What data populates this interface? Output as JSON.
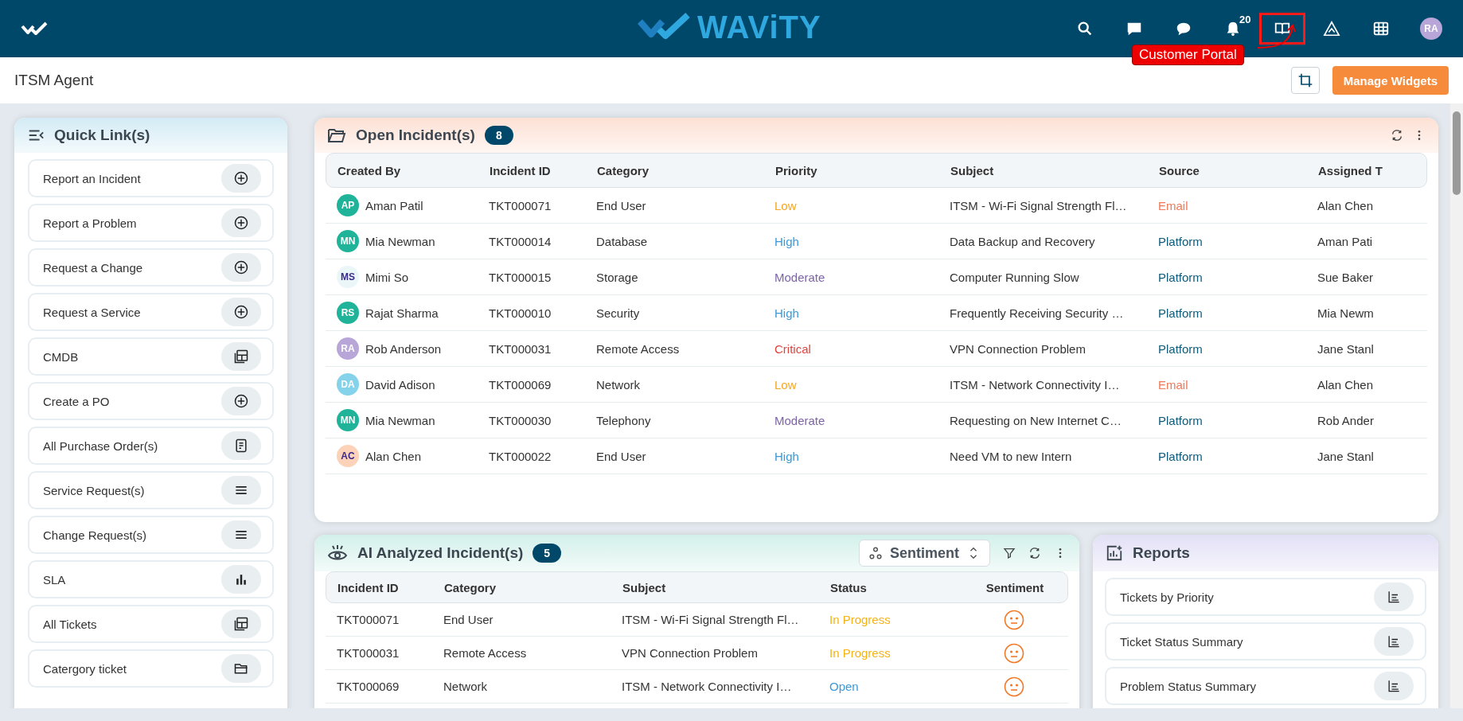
{
  "header": {
    "logo_text": "WAViTY",
    "nav": [
      {
        "highlighted": false
      },
      {
        "highlighted": false
      },
      {
        "highlighted": false
      },
      {
        "badge": "20",
        "highlighted": false
      },
      {
        "highlighted": true
      },
      {
        "highlighted": false
      },
      {
        "highlighted": false
      }
    ],
    "avatar": {
      "initials": "RA",
      "color": "#b9a6d9"
    },
    "callout": {
      "label": "Customer Portal"
    }
  },
  "subheader": {
    "title": "ITSM Agent",
    "button": "Manage Widgets"
  },
  "quick_links": {
    "title": "Quick Link(s)",
    "items": [
      {
        "label": "Report an Incident",
        "kind": "plus"
      },
      {
        "label": "Report a Problem",
        "kind": "plus"
      },
      {
        "label": "Request a Change",
        "kind": "plus"
      },
      {
        "label": "Request a Service",
        "kind": "plus"
      },
      {
        "label": "CMDB",
        "kind": "layout"
      },
      {
        "label": "Create a PO",
        "kind": "plus"
      },
      {
        "label": "All Purchase Order(s)",
        "kind": "doc"
      },
      {
        "label": "Service Request(s)",
        "kind": "lines"
      },
      {
        "label": "Change Request(s)",
        "kind": "lines"
      },
      {
        "label": "SLA",
        "kind": "bars"
      },
      {
        "label": "All Tickets",
        "kind": "layout"
      },
      {
        "label": "Catergory ticket",
        "kind": "folder"
      }
    ]
  },
  "open_incidents": {
    "title": "Open Incident(s)",
    "count": "8",
    "columns": [
      "Created By",
      "Incident ID",
      "Category",
      "Priority",
      "Subject",
      "Source",
      "Assigned T"
    ],
    "rows": [
      {
        "initials": "AP",
        "color": "#1fb39a",
        "created_by": "Aman Patil",
        "id": "TKT000071",
        "category": "End User",
        "priority": {
          "text": "Low",
          "color": "#f5a623"
        },
        "subject": "ITSM - Wi-Fi Signal Strength Fl…",
        "source": {
          "text": "Email",
          "color": "#f07857"
        },
        "assigned": "Alan Chen"
      },
      {
        "initials": "MN",
        "color": "#1fb39a",
        "created_by": "Mia Newman",
        "id": "TKT000014",
        "category": "Database",
        "priority": {
          "text": "High",
          "color": "#3a9ad9"
        },
        "subject": "Data Backup and Recovery",
        "source": {
          "text": "Platform",
          "color": "#0d5a7a"
        },
        "assigned": "Aman Pati"
      },
      {
        "initials": "MS",
        "color": "#eaf6f8",
        "created_by": "Mimi So",
        "id": "TKT000015",
        "category": "Storage",
        "priority": {
          "text": "Moderate",
          "color": "#7d64a8"
        },
        "subject": "Computer Running Slow",
        "source": {
          "text": "Platform",
          "color": "#0d5a7a"
        },
        "assigned": "Sue Baker"
      },
      {
        "initials": "RS",
        "color": "#1fb39a",
        "created_by": "Rajat Sharma",
        "id": "TKT000010",
        "category": "Security",
        "priority": {
          "text": "High",
          "color": "#3a9ad9"
        },
        "subject": "Frequently Receiving Security …",
        "source": {
          "text": "Platform",
          "color": "#0d5a7a"
        },
        "assigned": "Mia Newm"
      },
      {
        "initials": "RA",
        "color": "#b9a6d9",
        "created_by": "Rob Anderson",
        "id": "TKT000031",
        "category": "Remote Access",
        "priority": {
          "text": "Critical",
          "color": "#e0443c"
        },
        "subject": "VPN Connection Problem",
        "source": {
          "text": "Platform",
          "color": "#0d5a7a"
        },
        "assigned": "Jane Stanl"
      },
      {
        "initials": "DA",
        "color": "#84d3ea",
        "created_by": "David Adison",
        "id": "TKT000069",
        "category": "Network",
        "priority": {
          "text": "Low",
          "color": "#f5a623"
        },
        "subject": "ITSM - Network Connectivity I…",
        "source": {
          "text": "Email",
          "color": "#f07857"
        },
        "assigned": "Alan Chen"
      },
      {
        "initials": "MN",
        "color": "#1fb39a",
        "created_by": "Mia Newman",
        "id": "TKT000030",
        "category": "Telephony",
        "priority": {
          "text": "Moderate",
          "color": "#7d64a8"
        },
        "subject": "Requesting on New Internet C…",
        "source": {
          "text": "Platform",
          "color": "#0d5a7a"
        },
        "assigned": "Rob Ander"
      },
      {
        "initials": "AC",
        "color": "#fcd2b8",
        "created_by": "Alan Chen",
        "id": "TKT000022",
        "category": "End User",
        "priority": {
          "text": "High",
          "color": "#3a9ad9"
        },
        "subject": "Need VM to new Intern",
        "source": {
          "text": "Platform",
          "color": "#0d5a7a"
        },
        "assigned": "Jane Stanl"
      }
    ]
  },
  "ai_incidents": {
    "title": "AI Analyzed Incident(s)",
    "count": "5",
    "selector": "Sentiment",
    "columns": [
      "Incident ID",
      "Category",
      "Subject",
      "Status",
      "Sentiment"
    ],
    "rows": [
      {
        "id": "TKT000071",
        "category": "End User",
        "subject": "ITSM - Wi-Fi Signal Strength Fl…",
        "status": {
          "text": "In Progress",
          "color": "#f5b316"
        }
      },
      {
        "id": "TKT000031",
        "category": "Remote Access",
        "subject": "VPN Connection Problem",
        "status": {
          "text": "In Progress",
          "color": "#f5b316"
        }
      },
      {
        "id": "TKT000069",
        "category": "Network",
        "subject": "ITSM - Network Connectivity I…",
        "status": {
          "text": "Open",
          "color": "#3a9ad9"
        }
      }
    ]
  },
  "reports": {
    "title": "Reports",
    "items": [
      {
        "label": "Tickets by Priority"
      },
      {
        "label": "Ticket Status Summary"
      },
      {
        "label": "Problem Status Summary"
      }
    ]
  }
}
